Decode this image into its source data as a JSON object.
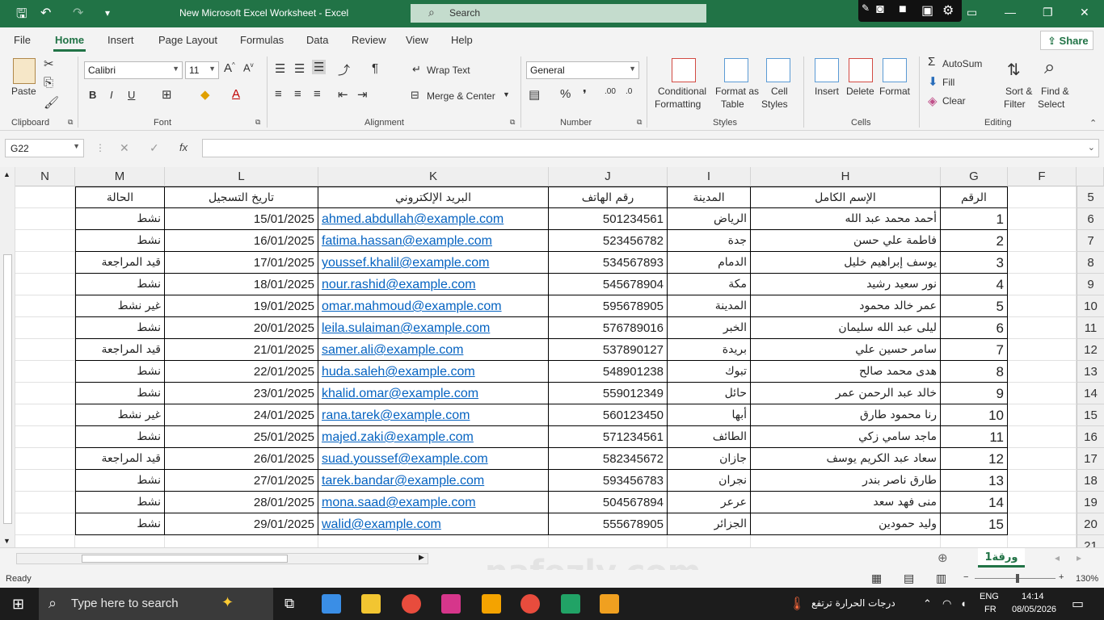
{
  "titlebar": {
    "title": "New Microsoft Excel Worksheet  -  Excel",
    "search_placeholder": "Search"
  },
  "menu": {
    "tabs": [
      "File",
      "Home",
      "Insert",
      "Page Layout",
      "Formulas",
      "Data",
      "Review",
      "View",
      "Help"
    ],
    "active": "Home",
    "share": "Share"
  },
  "ribbon": {
    "paste": "Paste",
    "clipboard": "Clipboard",
    "font_name": "Calibri",
    "font_size": "11",
    "font": "Font",
    "bold": "B",
    "italic": "I",
    "underline": "U",
    "wrap_text": "Wrap Text",
    "merge_center": "Merge & Center",
    "alignment": "Alignment",
    "number_format": "General",
    "number": "Number",
    "conditional_formatting_1": "Conditional",
    "conditional_formatting_2": "Formatting",
    "format_as_table_1": "Format as",
    "format_as_table_2": "Table",
    "cell_styles_1": "Cell",
    "cell_styles_2": "Styles",
    "styles": "Styles",
    "insert": "Insert",
    "delete": "Delete",
    "format": "Format",
    "cells": "Cells",
    "autosum": "AutoSum",
    "fill": "Fill",
    "clear": "Clear",
    "sort_filter_1": "Sort &",
    "sort_filter_2": "Filter",
    "find_select_1": "Find &",
    "find_select_2": "Select",
    "editing": "Editing"
  },
  "formula_bar": {
    "name_box": "G22",
    "fx": "fx",
    "value": ""
  },
  "columns": [
    "N",
    "M",
    "L",
    "K",
    "J",
    "I",
    "H",
    "G",
    "F"
  ],
  "row_numbers": [
    "5",
    "6",
    "7",
    "8",
    "9",
    "10",
    "11",
    "12",
    "13",
    "14",
    "15",
    "16",
    "17",
    "18",
    "19",
    "20",
    "21"
  ],
  "table": {
    "headers": {
      "status": "الحالة",
      "reg_date": "تاريخ التسجيل",
      "email": "البريد الإلكتروني",
      "phone": "رقم الهاتف",
      "city": "المدينة",
      "name": "الإسم الكامل",
      "id": "الرقم"
    },
    "rows": [
      {
        "id": "1",
        "name": "أحمد محمد عبد الله",
        "city": "الرياض",
        "phone": "501234561",
        "email": "ahmed.abdullah@example.com",
        "date": "15/01/2025",
        "status": "نشط"
      },
      {
        "id": "2",
        "name": "فاطمة علي حسن",
        "city": "جدة",
        "phone": "523456782",
        "email": "fatima.hassan@example.com",
        "date": "16/01/2025",
        "status": "نشط"
      },
      {
        "id": "3",
        "name": "يوسف إبراهيم خليل",
        "city": "الدمام",
        "phone": "534567893",
        "email": "youssef.khalil@example.com",
        "date": "17/01/2025",
        "status": "قيد المراجعة"
      },
      {
        "id": "4",
        "name": "نور سعيد رشيد",
        "city": "مكة",
        "phone": "545678904",
        "email": "nour.rashid@example.com",
        "date": "18/01/2025",
        "status": "نشط"
      },
      {
        "id": "5",
        "name": "عمر خالد محمود",
        "city": "المدينة",
        "phone": "595678905",
        "email": "omar.mahmoud@example.com",
        "date": "19/01/2025",
        "status": "غير نشط"
      },
      {
        "id": "6",
        "name": "ليلى عبد الله سليمان",
        "city": "الخبر",
        "phone": "576789016",
        "email": "leila.sulaiman@example.com",
        "date": "20/01/2025",
        "status": "نشط"
      },
      {
        "id": "7",
        "name": "سامر حسين علي",
        "city": "بريدة",
        "phone": "537890127",
        "email": "samer.ali@example.com",
        "date": "21/01/2025",
        "status": "قيد المراجعة"
      },
      {
        "id": "8",
        "name": "هدى محمد صالح",
        "city": "تبوك",
        "phone": "548901238",
        "email": "huda.saleh@example.com",
        "date": "22/01/2025",
        "status": "نشط"
      },
      {
        "id": "9",
        "name": "خالد عبد الرحمن عمر",
        "city": "حائل",
        "phone": "559012349",
        "email": "khalid.omar@example.com",
        "date": "23/01/2025",
        "status": "نشط"
      },
      {
        "id": "10",
        "name": "رنا محمود طارق",
        "city": "أبها",
        "phone": "560123450",
        "email": "rana.tarek@example.com",
        "date": "24/01/2025",
        "status": "غير نشط"
      },
      {
        "id": "11",
        "name": "ماجد سامي زكي",
        "city": "الطائف",
        "phone": "571234561",
        "email": "majed.zaki@example.com",
        "date": "25/01/2025",
        "status": "نشط"
      },
      {
        "id": "12",
        "name": "سعاد عبد الكريم يوسف",
        "city": "جازان",
        "phone": "582345672",
        "email": "suad.youssef@example.com",
        "date": "26/01/2025",
        "status": "قيد المراجعة"
      },
      {
        "id": "13",
        "name": "طارق ناصر بندر",
        "city": "نجران",
        "phone": "593456783",
        "email": "tarek.bandar@example.com",
        "date": "27/01/2025",
        "status": "نشط"
      },
      {
        "id": "14",
        "name": "منى فهد سعد",
        "city": "عرعر",
        "phone": "504567894",
        "email": "mona.saad@example.com",
        "date": "28/01/2025",
        "status": "نشط"
      },
      {
        "id": "15",
        "name": "وليد حمودين",
        "city": "الجزائر",
        "phone": "555678905",
        "email": "walid@example.com",
        "date": "29/01/2025",
        "status": "نشط"
      }
    ]
  },
  "sheet_tab": "ورقة1",
  "status": {
    "ready": "Ready",
    "zoom": "130%"
  },
  "taskbar": {
    "search": "Type here to search",
    "weather": "درجات الحرارة ترتفع",
    "lang1": "ENG",
    "lang2": "FR",
    "time": "14:14",
    "date": "08/05/2026"
  },
  "watermark": "nafezly.com"
}
